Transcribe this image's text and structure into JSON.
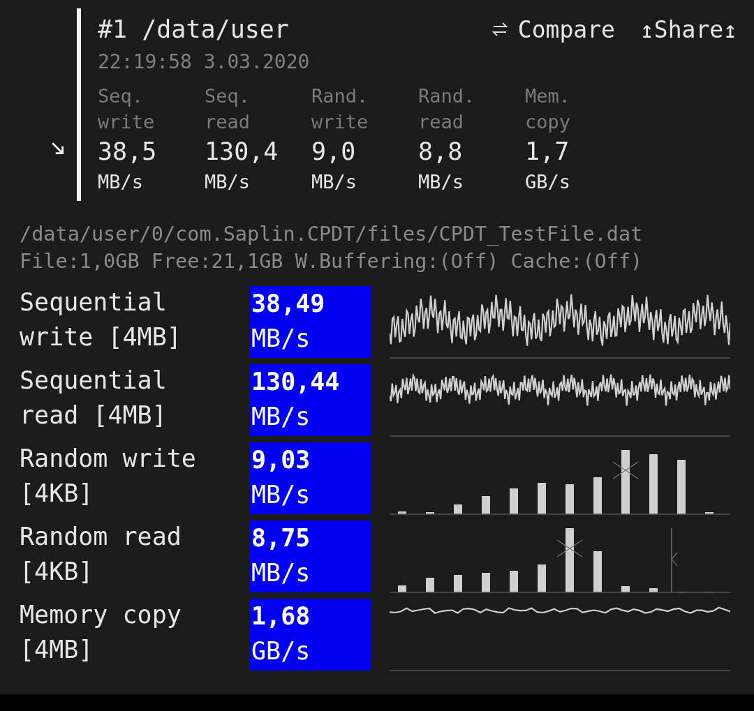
{
  "header": {
    "title": "#1 /data/user",
    "timestamp": "22:19:58 3.03.2020",
    "compare": "Compare",
    "share": "↥Share↥"
  },
  "metrics": [
    {
      "label": "Seq. write",
      "value": "38,5",
      "unit": "MB/s"
    },
    {
      "label": "Seq. read",
      "value": "130,4",
      "unit": "MB/s"
    },
    {
      "label": "Rand. write",
      "value": "9,0",
      "unit": "MB/s"
    },
    {
      "label": "Rand. read",
      "value": "8,8",
      "unit": "MB/s"
    },
    {
      "label": "Mem. copy",
      "value": "1,7",
      "unit": "GB/s"
    }
  ],
  "file": {
    "path": "/data/user/0/com.Saplin.CPDT/files/CPDT_TestFile.dat",
    "info": "File:1,0GB Free:21,1GB W.Buffering:(Off) Cache:(Off)"
  },
  "tests": [
    {
      "label": "Sequential write [4MB]",
      "value": "38,49",
      "unit": "MB/s",
      "kind": "line"
    },
    {
      "label": "Sequential read [4MB]",
      "value": "130,44",
      "unit": "MB/s",
      "kind": "line"
    },
    {
      "label": "Random write [4KB]",
      "value": "9,03",
      "unit": "MB/s",
      "kind": "bars"
    },
    {
      "label": "Random read [4KB]",
      "value": "8,75",
      "unit": "MB/s",
      "kind": "bars"
    },
    {
      "label": "Memory copy [4MB]",
      "value": "1,68",
      "unit": "GB/s",
      "kind": "line"
    }
  ]
}
